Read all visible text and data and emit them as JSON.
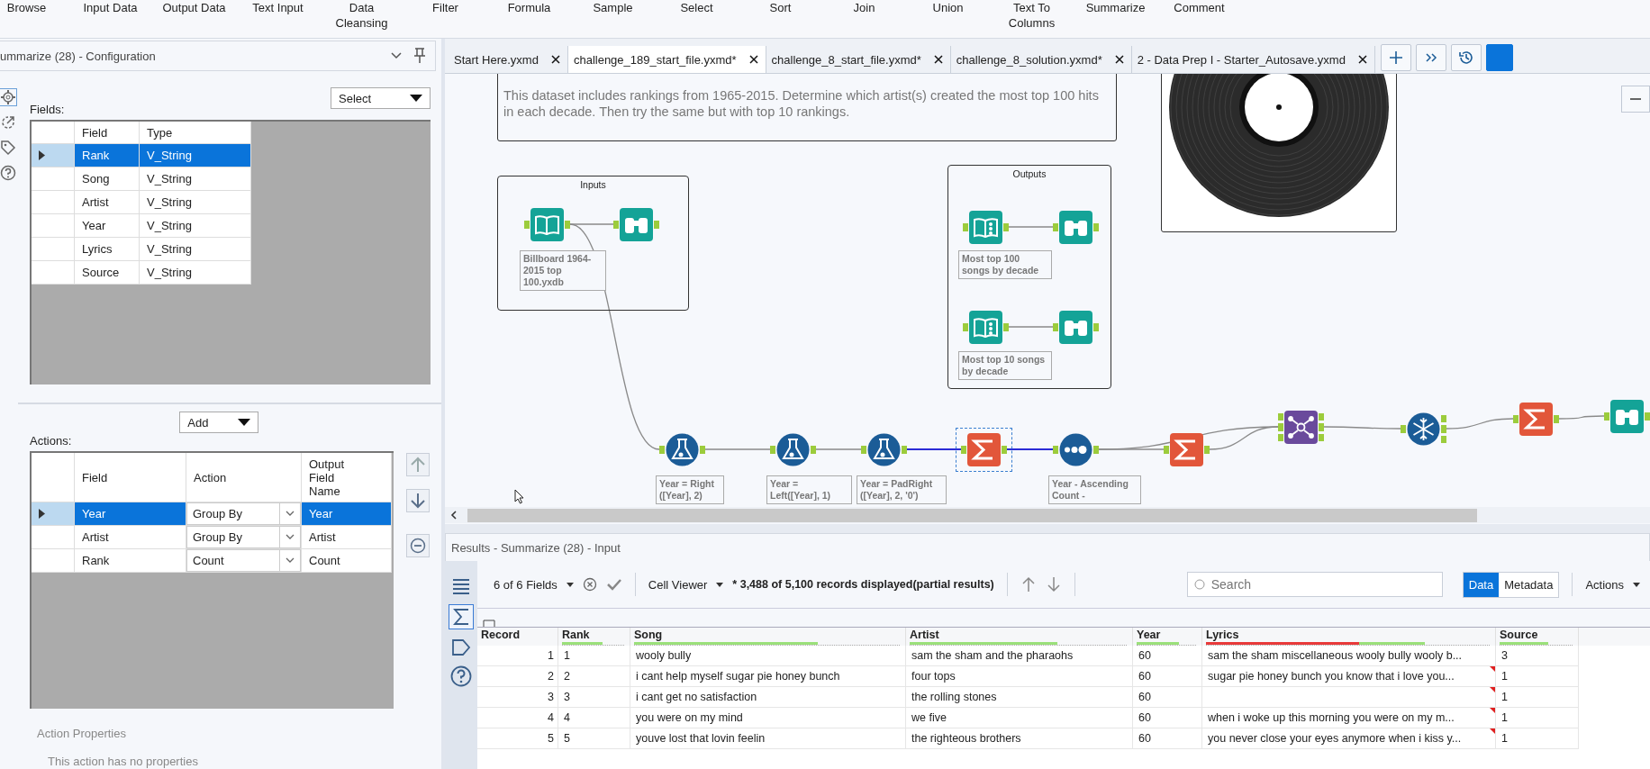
{
  "toolbar": {
    "tools": [
      "Browse",
      "Input Data",
      "Output Data",
      "Text Input",
      "Data Cleansing",
      "Filter",
      "Formula",
      "Sample",
      "Select",
      "Sort",
      "Join",
      "Union",
      "Text To Columns",
      "Summarize",
      "Comment"
    ]
  },
  "config_panel": {
    "title": "ummarize (28) - Configuration",
    "fields_label": "Fields:",
    "select_dropdown": "Select",
    "fields_table": {
      "columns": [
        "Field",
        "Type"
      ],
      "rows": [
        {
          "field": "Rank",
          "type": "V_String",
          "selected": true
        },
        {
          "field": "Song",
          "type": "V_String",
          "selected": false
        },
        {
          "field": "Artist",
          "type": "V_String",
          "selected": false
        },
        {
          "field": "Year",
          "type": "V_String",
          "selected": false
        },
        {
          "field": "Lyrics",
          "type": "V_String",
          "selected": false
        },
        {
          "field": "Source",
          "type": "V_String",
          "selected": false
        }
      ]
    },
    "actions_label": "Actions:",
    "add_dropdown": "Add",
    "actions_table": {
      "columns": [
        "Field",
        "Action",
        "Output Field Name"
      ],
      "rows": [
        {
          "field": "Year",
          "action": "Group By",
          "output": "Year",
          "selected": true
        },
        {
          "field": "Artist",
          "action": "Group By",
          "output": "Artist",
          "selected": false
        },
        {
          "field": "Rank",
          "action": "Count",
          "output": "Count",
          "selected": false
        }
      ]
    },
    "action_properties": {
      "title": "Action Properties",
      "message": "This action has no properties"
    }
  },
  "tabs": [
    {
      "label": "Start Here.yxmd",
      "selected": false
    },
    {
      "label": "challenge_189_start_file.yxmd*",
      "selected": true
    },
    {
      "label": "challenge_8_start_file.yxmd*",
      "selected": false
    },
    {
      "label": "challenge_8_solution.yxmd*",
      "selected": false
    },
    {
      "label": "2 - Data Prep I - Starter_Autosave.yxmd",
      "selected": false
    }
  ],
  "canvas": {
    "comment": "This dataset includes rankings from 1965-2015. Determine which artist(s) created the most top 100 hits in each decade. Then try the same but with top 10 rankings.",
    "containers": [
      {
        "title": "Inputs"
      },
      {
        "title": "Outputs"
      }
    ],
    "nodes": [
      {
        "kind": "input",
        "label": "Billboard 1964-2015 top 100.yxdb",
        "selected": false
      },
      {
        "kind": "browse",
        "selected": false
      },
      {
        "kind": "output",
        "label": "Most top 100 songs by decade",
        "selected": false
      },
      {
        "kind": "browse",
        "selected": false
      },
      {
        "kind": "output",
        "label": "Most top 10 songs by decade",
        "selected": false
      },
      {
        "kind": "browse",
        "selected": false
      },
      {
        "kind": "formula",
        "label": "Year = Right ([Year], 2)",
        "selected": false
      },
      {
        "kind": "formula",
        "label": "Year = Left([Year], 1)",
        "selected": false
      },
      {
        "kind": "formula",
        "label": "Year = PadRight ([Year], 2, '0')",
        "selected": false
      },
      {
        "kind": "summarize",
        "selected": true
      },
      {
        "kind": "sort",
        "label": "Year - Ascending Count -",
        "selected": false
      },
      {
        "kind": "summarize",
        "selected": false
      },
      {
        "kind": "join",
        "selected": false
      },
      {
        "kind": "crosstab",
        "selected": false
      },
      {
        "kind": "summarize",
        "selected": false
      },
      {
        "kind": "browse",
        "selected": false
      }
    ]
  },
  "results": {
    "title": "Results - Summarize (28) - Input",
    "fields_button": "6 of 6 Fields",
    "cell_viewer": "Cell Viewer",
    "status": "* 3,488 of 5,100 records displayed(partial results)",
    "search_placeholder": "Search",
    "view_tabs": [
      {
        "label": "Data",
        "selected": true
      },
      {
        "label": "Metadata",
        "selected": false
      }
    ],
    "actions": "Actions",
    "columns": [
      {
        "label": "Record"
      },
      {
        "label": "Rank",
        "level": 0.65,
        "flagged": false
      },
      {
        "label": "Song",
        "level": 0.69,
        "flagged": false
      },
      {
        "label": "Artist",
        "level": 0.68,
        "flagged": false
      },
      {
        "label": "Year",
        "level": 0.71,
        "flagged": false
      },
      {
        "label": "Lyrics",
        "level": 0.77,
        "flagged": true
      },
      {
        "label": "Source",
        "level": 0.67,
        "flagged": false
      }
    ],
    "rows": [
      {
        "record": "1",
        "rank": "1",
        "song": "wooly bully",
        "artist": "sam the sham and the pharaohs",
        "year": "60",
        "lyrics": "sam the sham miscellaneous wooly bully wooly b...",
        "source": "3",
        "truncated": false
      },
      {
        "record": "2",
        "rank": "2",
        "song": "i cant help myself sugar pie honey bunch",
        "artist": "four tops",
        "year": "60",
        "lyrics": " sugar pie honey bunch you know that i love you...",
        "source": "1",
        "truncated": true
      },
      {
        "record": "3",
        "rank": "3",
        "song": "i cant get no satisfaction",
        "artist": "the rolling stones",
        "year": "60",
        "lyrics": "",
        "source": "1",
        "truncated": true
      },
      {
        "record": "4",
        "rank": "4",
        "song": "you were on my mind",
        "artist": "we five",
        "year": "60",
        "lyrics": " when i woke up this morning you were on my m...",
        "source": "1",
        "truncated": true
      },
      {
        "record": "5",
        "rank": "5",
        "song": "youve lost that lovin feelin",
        "artist": "the righteous brothers",
        "year": "60",
        "lyrics": " you never close your eyes anymore when i kiss y...",
        "source": "1",
        "truncated": true
      }
    ]
  }
}
